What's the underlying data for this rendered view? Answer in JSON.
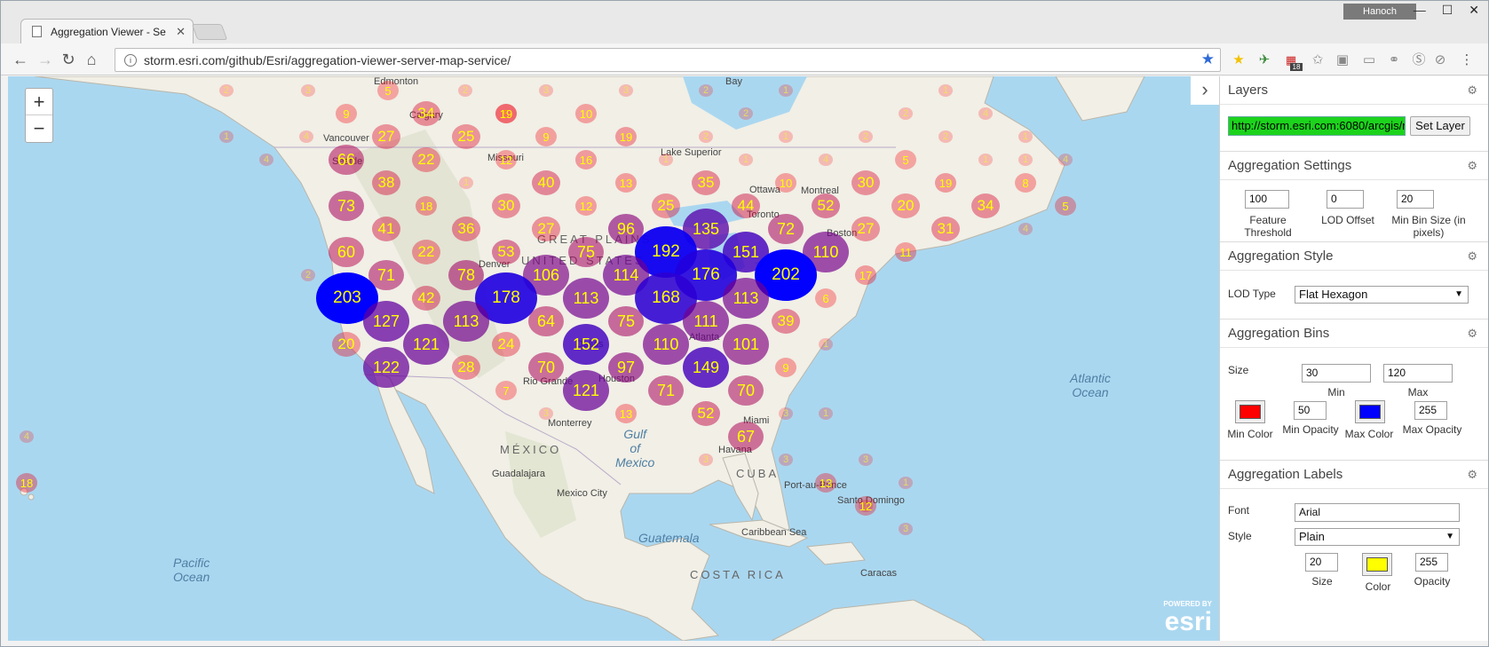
{
  "browser": {
    "tab_title": "Aggregation Viewer - Se",
    "user_badge": "Hanoch",
    "url": "storm.esri.com/github/Esri/aggregation-viewer-server-map-service/",
    "calendar_badge": "18"
  },
  "map": {
    "zoom_in": "+",
    "zoom_out": "−",
    "attribution_powered": "POWERED BY",
    "attribution_logo": "esri",
    "labels": [
      {
        "text": "Edmonton"
      },
      {
        "text": "Calgary"
      },
      {
        "text": "Vancouver"
      },
      {
        "text": "Seattle"
      },
      {
        "text": "Missouri"
      },
      {
        "text": "Lake Superior"
      },
      {
        "text": "Ottawa"
      },
      {
        "text": "Montreal"
      },
      {
        "text": "Toronto"
      },
      {
        "text": "Boston"
      },
      {
        "text": "Denver"
      },
      {
        "text": "GREAT PLAINS"
      },
      {
        "text": "UNITED STATES"
      },
      {
        "text": "Atlanta"
      },
      {
        "text": "Dallas"
      },
      {
        "text": "Houston"
      },
      {
        "text": "Miami"
      },
      {
        "text": "Monterrey"
      },
      {
        "text": "Gulf of Mexico"
      },
      {
        "text": "MÉXICO"
      },
      {
        "text": "Guadalajara"
      },
      {
        "text": "Mexico City"
      },
      {
        "text": "Havana"
      },
      {
        "text": "CUBA"
      },
      {
        "text": "Port-au-Prince"
      },
      {
        "text": "Santo Domingo"
      },
      {
        "text": "Guatemala"
      },
      {
        "text": "Caribbean Sea"
      },
      {
        "text": "COSTA RICA"
      },
      {
        "text": "Caracas"
      },
      {
        "text": "Pacific Ocean"
      },
      {
        "text": "Atlantic Ocean"
      },
      {
        "text": "Rio Grande"
      },
      {
        "text": "Bay"
      }
    ],
    "bins": [
      {
        "v": "2"
      },
      {
        "v": "3"
      },
      {
        "v": "5"
      },
      {
        "v": "2"
      },
      {
        "v": "3"
      },
      {
        "v": "3"
      },
      {
        "v": "2"
      },
      {
        "v": "1"
      },
      {
        "v": "1"
      },
      {
        "v": "9"
      },
      {
        "v": "34"
      },
      {
        "v": "5"
      },
      {
        "v": "19"
      },
      {
        "v": "10"
      },
      {
        "v": "2"
      },
      {
        "v": "2"
      },
      {
        "v": "4"
      },
      {
        "v": "1"
      },
      {
        "v": "4"
      },
      {
        "v": "27"
      },
      {
        "v": "25"
      },
      {
        "v": "9"
      },
      {
        "v": "19"
      },
      {
        "v": "2"
      },
      {
        "v": "1"
      },
      {
        "v": "2"
      },
      {
        "v": "2"
      },
      {
        "v": "1"
      },
      {
        "v": "4"
      },
      {
        "v": "66"
      },
      {
        "v": "22"
      },
      {
        "v": "12"
      },
      {
        "v": "16"
      },
      {
        "v": "1"
      },
      {
        "v": "1"
      },
      {
        "v": "4"
      },
      {
        "v": "5"
      },
      {
        "v": "1"
      },
      {
        "v": "1"
      },
      {
        "v": "4"
      },
      {
        "v": "38"
      },
      {
        "v": "1"
      },
      {
        "v": "40"
      },
      {
        "v": "13"
      },
      {
        "v": "35"
      },
      {
        "v": "10"
      },
      {
        "v": "30"
      },
      {
        "v": "19"
      },
      {
        "v": "8"
      },
      {
        "v": "73"
      },
      {
        "v": "18"
      },
      {
        "v": "30"
      },
      {
        "v": "12"
      },
      {
        "v": "25"
      },
      {
        "v": "44"
      },
      {
        "v": "52"
      },
      {
        "v": "20"
      },
      {
        "v": "34"
      },
      {
        "v": "5"
      },
      {
        "v": "41"
      },
      {
        "v": "36"
      },
      {
        "v": "27"
      },
      {
        "v": "96"
      },
      {
        "v": "135"
      },
      {
        "v": "72"
      },
      {
        "v": "27"
      },
      {
        "v": "31"
      },
      {
        "v": "4"
      },
      {
        "v": "60"
      },
      {
        "v": "22"
      },
      {
        "v": "53"
      },
      {
        "v": "75"
      },
      {
        "v": "192"
      },
      {
        "v": "151"
      },
      {
        "v": "110"
      },
      {
        "v": "11"
      },
      {
        "v": "2"
      },
      {
        "v": "71"
      },
      {
        "v": "78"
      },
      {
        "v": "106"
      },
      {
        "v": "114"
      },
      {
        "v": "176"
      },
      {
        "v": "202"
      },
      {
        "v": "17"
      },
      {
        "v": "203"
      },
      {
        "v": "42"
      },
      {
        "v": "178"
      },
      {
        "v": "113"
      },
      {
        "v": "168"
      },
      {
        "v": "113"
      },
      {
        "v": "6"
      },
      {
        "v": "127"
      },
      {
        "v": "113"
      },
      {
        "v": "64"
      },
      {
        "v": "75"
      },
      {
        "v": "111"
      },
      {
        "v": "39"
      },
      {
        "v": "20"
      },
      {
        "v": "121"
      },
      {
        "v": "24"
      },
      {
        "v": "152"
      },
      {
        "v": "110"
      },
      {
        "v": "101"
      },
      {
        "v": "1"
      },
      {
        "v": "122"
      },
      {
        "v": "28"
      },
      {
        "v": "70"
      },
      {
        "v": "97"
      },
      {
        "v": "149"
      },
      {
        "v": "9"
      },
      {
        "v": "7"
      },
      {
        "v": "121"
      },
      {
        "v": "71"
      },
      {
        "v": "70"
      },
      {
        "v": "3"
      },
      {
        "v": "13"
      },
      {
        "v": "52"
      },
      {
        "v": "3"
      },
      {
        "v": "4"
      },
      {
        "v": "1"
      },
      {
        "v": "67"
      },
      {
        "v": "18"
      },
      {
        "v": "3"
      },
      {
        "v": "3"
      },
      {
        "v": "3"
      },
      {
        "v": "1"
      },
      {
        "v": "13"
      },
      {
        "v": "1"
      },
      {
        "v": "12"
      },
      {
        "v": "3"
      }
    ]
  },
  "panel": {
    "layers": {
      "title": "Layers",
      "url_value": "http://storm.esri.com:6080/arcgis/rest",
      "set_layer": "Set Layer"
    },
    "settings": {
      "title": "Aggregation Settings",
      "feature_threshold": "100",
      "feature_threshold_label": "Feature Threshold",
      "lod_offset": "0",
      "lod_offset_label": "LOD Offset",
      "min_bin_size": "20",
      "min_bin_size_label": "Min Bin Size (in pixels)"
    },
    "style": {
      "title": "Aggregation Style",
      "lod_type_label": "LOD Type",
      "lod_type_value": "Flat Hexagon"
    },
    "bins": {
      "title": "Aggregation Bins",
      "size_label": "Size",
      "min_value": "30",
      "min_label": "Min",
      "max_value": "120",
      "max_label": "Max",
      "min_color_label": "Min Color",
      "min_color": "#ff0000",
      "min_opacity": "50",
      "min_opacity_label": "Min Opacity",
      "max_color_label": "Max Color",
      "max_color": "#0000ff",
      "max_opacity": "255",
      "max_opacity_label": "Max Opacity"
    },
    "labels": {
      "title": "Aggregation Labels",
      "font_label": "Font",
      "font_value": "Arial",
      "style_label": "Style",
      "style_value": "Plain",
      "size_value": "20",
      "size_label": "Size",
      "color_label": "Color",
      "color": "#ffff00",
      "opacity_value": "255",
      "opacity_label": "Opacity"
    }
  }
}
